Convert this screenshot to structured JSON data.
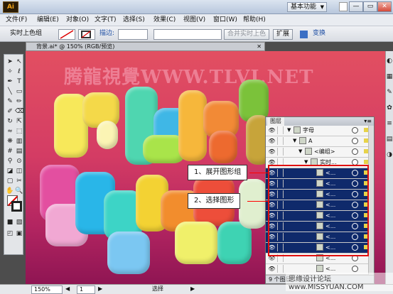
{
  "app": {
    "logo": "Ai",
    "workspace": "基本功能"
  },
  "window_controls": {
    "minimize": "—",
    "restore": "▭",
    "close": "✕"
  },
  "menu": [
    "文件(F)",
    "编辑(E)",
    "对象(O)",
    "文字(T)",
    "选择(S)",
    "效果(C)",
    "视图(V)",
    "窗口(W)",
    "帮助(H)"
  ],
  "control_bar": {
    "mode": "实时上色组",
    "stroke_label": "描边:",
    "merge_button": "合并实时上色",
    "expand_button": "扩展",
    "interchange_link": "变换"
  },
  "document": {
    "tab_title": "背景.ai* @ 150% (RGB/预览)",
    "close": "✕"
  },
  "watermark": "腾龍視覺WWW.TLVI.NET",
  "layers_panel": {
    "title": "图层",
    "menu_icon": "▾≡",
    "rows": [
      {
        "label": "字母",
        "indent": 0,
        "selected": false
      },
      {
        "label": "A",
        "indent": 1,
        "selected": false
      },
      {
        "label": "<编组>",
        "indent": 2,
        "selected": false
      },
      {
        "label": "实时...",
        "indent": 3,
        "selected": false
      },
      {
        "label": "<...",
        "indent": 4,
        "selected": true
      },
      {
        "label": "<...",
        "indent": 4,
        "selected": true
      },
      {
        "label": "<...",
        "indent": 4,
        "selected": true
      },
      {
        "label": "<...",
        "indent": 4,
        "selected": true
      },
      {
        "label": "<...",
        "indent": 4,
        "selected": true
      },
      {
        "label": "<...",
        "indent": 4,
        "selected": true
      },
      {
        "label": "<...",
        "indent": 4,
        "selected": true
      },
      {
        "label": "<...",
        "indent": 4,
        "selected": true
      },
      {
        "label": "<...",
        "indent": 4,
        "selected": false
      },
      {
        "label": "<...",
        "indent": 4,
        "selected": false
      }
    ],
    "footer": "9 个图层"
  },
  "callouts": {
    "step1": "1、展开图形组",
    "step2": "2、选择图形"
  },
  "status_bar": {
    "zoom": "150%",
    "page": "1",
    "tool": "选择"
  },
  "site_watermark": "思缘设计论坛 www.MISSYUAN.COM"
}
